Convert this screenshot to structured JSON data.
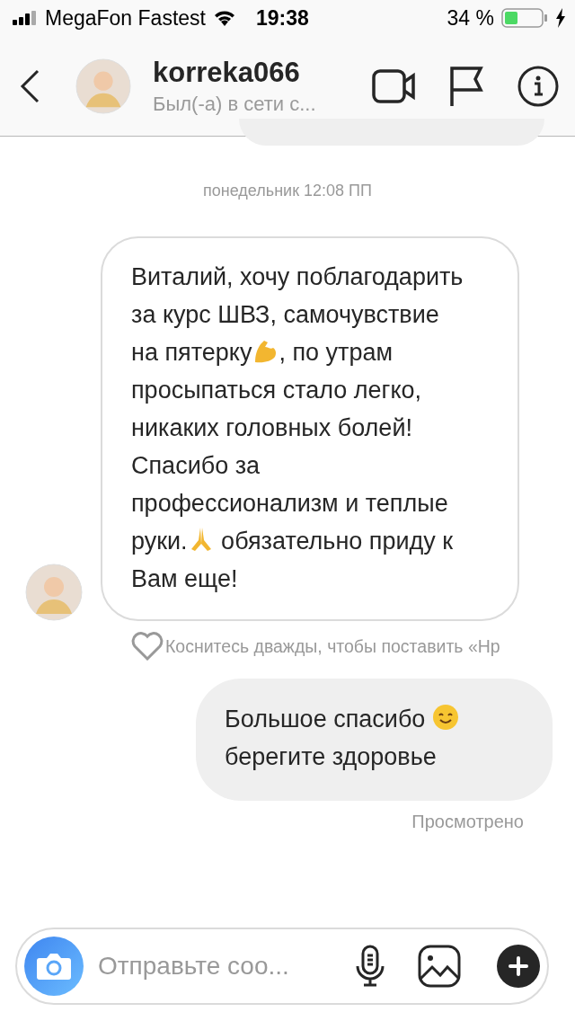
{
  "status_bar": {
    "carrier": "MegaFon Fastest",
    "time": "19:38",
    "battery": "34 %"
  },
  "header": {
    "username": "korreka066",
    "status": "Был(-а) в сети с..."
  },
  "timestamp": "понедельник 12:08 ПП",
  "messages": [
    {
      "kind": "received",
      "parts": [
        {
          "kind": "text",
          "text": "Виталий, хочу поблагодарить за курс ШВЗ, самочувствие на пятерку"
        },
        {
          "kind": "flex-emoji"
        },
        {
          "kind": "text",
          "text": ", по утрам просыпаться стало легко, никаких головных болей! Спасибо за профессионализм и теплые руки."
        },
        {
          "kind": "pray-emoji"
        },
        {
          "kind": "text",
          "text": " обязательно приду к Вам еще!"
        }
      ],
      "hint": "Коснитесь дважды, чтобы поставить «Нр"
    },
    {
      "kind": "sent",
      "parts": [
        {
          "kind": "text",
          "text": "Большое спасибо "
        },
        {
          "kind": "smile-emoji"
        },
        {
          "kind": "text",
          "text": " берегите здоровье"
        }
      ],
      "receipt": "Просмотрено"
    }
  ],
  "composer": {
    "placeholder": "Отправьте соо..."
  }
}
